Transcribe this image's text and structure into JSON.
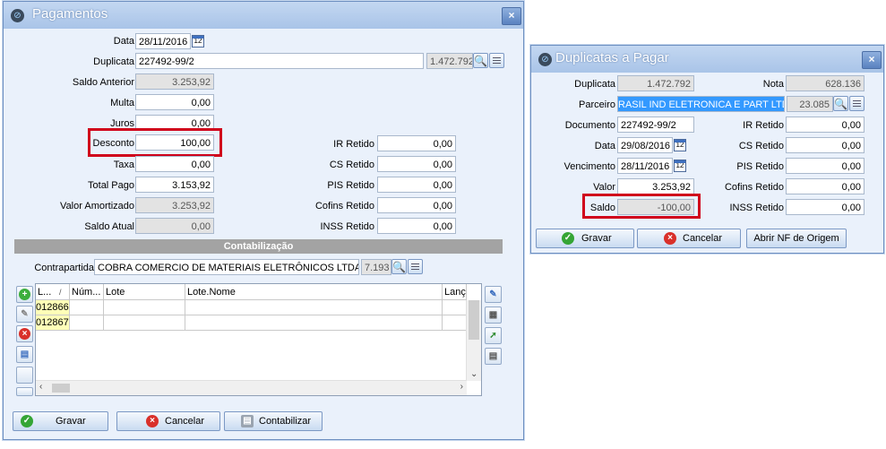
{
  "pagamentos": {
    "title": "Pagamentos",
    "close": "×",
    "data_label": "Data",
    "data_value": "28/11/2016",
    "duplicata_label": "Duplicata",
    "duplicata_value": "227492-99/2",
    "duplicata_code": "1.472.792",
    "saldo_anterior_label": "Saldo Anterior",
    "saldo_anterior_value": "3.253,92",
    "multa_label": "Multa",
    "multa_value": "0,00",
    "juros_label": "Juros",
    "juros_value": "0,00",
    "desconto_label": "Desconto",
    "desconto_value": "100,00",
    "taxa_label": "Taxa",
    "taxa_value": "0,00",
    "total_pago_label": "Total Pago",
    "total_pago_value": "3.153,92",
    "valor_amortizado_label": "Valor Amortizado",
    "valor_amortizado_value": "3.253,92",
    "saldo_atual_label": "Saldo Atual",
    "saldo_atual_value": "0,00",
    "ir_label": "IR Retido",
    "ir_value": "0,00",
    "cs_label": "CS Retido",
    "cs_value": "0,00",
    "pis_label": "PIS Retido",
    "pis_value": "0,00",
    "cofins_label": "Cofins Retido",
    "cofins_value": "0,00",
    "inss_label": "INSS Retido",
    "inss_value": "0,00",
    "section_title": "Contabilização",
    "contrapartida_label": "Contrapartida",
    "contrapartida_value": "COBRA COMERCIO DE MATERIAIS ELETRÔNICOS LTDA",
    "contrapartida_code": "7.193",
    "grid": {
      "columns": [
        "L...",
        "Núm...",
        "Lote",
        "Lote.Nome",
        "Lanç..."
      ],
      "sort_marker": "/",
      "rows": [
        [
          "012866",
          "",
          "",
          "",
          ""
        ],
        [
          "012867",
          "",
          "",
          "",
          ""
        ]
      ]
    },
    "btn_gravar": "Gravar",
    "btn_cancelar": "Cancelar",
    "btn_contabilizar": "Contabilizar"
  },
  "duplicatas": {
    "title": "Duplicatas a Pagar",
    "close": "×",
    "duplicata_label": "Duplicata",
    "duplicata_value": "1.472.792",
    "nota_label": "Nota",
    "nota_value": "628.136",
    "parceiro_label": "Parceiro",
    "parceiro_value": "RASIL IND ELETRONICA E PART LTDA",
    "parceiro_code": "23.085",
    "documento_label": "Documento",
    "documento_value": "227492-99/2",
    "data_label": "Data",
    "data_value": "29/08/2016",
    "vencimento_label": "Vencimento",
    "vencimento_value": "28/11/2016",
    "valor_label": "Valor",
    "valor_value": "3.253,92",
    "saldo_label": "Saldo",
    "saldo_value": "-100,00",
    "ir_label": "IR Retido",
    "ir_value": "0,00",
    "cs_label": "CS Retido",
    "cs_value": "0,00",
    "pis_label": "PIS Retido",
    "pis_value": "0,00",
    "cofins_label": "Cofins Retido",
    "cofins_value": "0,00",
    "inss_label": "INSS Retido",
    "inss_value": "0,00",
    "btn_gravar": "Gravar",
    "btn_cancelar": "Cancelar",
    "btn_abrir": "Abrir NF de Origem"
  },
  "colors": {
    "title_bar": "#b6cdec",
    "highlight": "#d0021b",
    "section": "#a3a3a3",
    "selection": "#3399ff"
  }
}
